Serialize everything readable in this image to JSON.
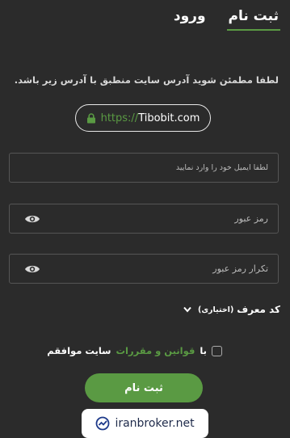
{
  "tabs": [
    {
      "label": "ورود",
      "active": false
    },
    {
      "label": "ثبت نام",
      "active": true
    }
  ],
  "notice": "لطفا مطمئن شوید آدرس سایت منطبق با آدرس زیر باشد.",
  "url": {
    "prefix": "https://",
    "domain": "Tibobit.com"
  },
  "fields": {
    "email": {
      "placeholder": "لطفا ایمیل خود را وارد نمایید"
    },
    "password": {
      "placeholder": "رمز عبور"
    },
    "confirm": {
      "placeholder": "تکرار رمز عبور"
    }
  },
  "referral": {
    "label": "کد معرف",
    "optional": "(اختیاری)"
  },
  "agreement": {
    "prefix": "با",
    "link": "قوانین و مقررات",
    "suffix": "سایت موافقم"
  },
  "submit_label": "ثبت نام",
  "watermark": "iranbroker.net",
  "colors": {
    "accent": "#5a9a43",
    "background": "#2b2b2b"
  }
}
